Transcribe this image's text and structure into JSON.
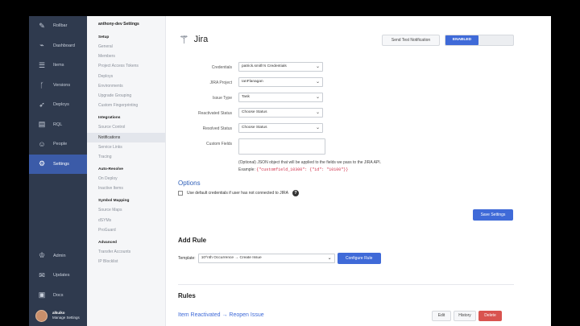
{
  "nav": {
    "items": [
      {
        "label": "Rollbar",
        "icon": "rollbar-logo-icon",
        "glyph": "✎"
      },
      {
        "label": "Dashboard",
        "icon": "dashboard-chart-icon",
        "glyph": "⌁"
      },
      {
        "label": "Items",
        "icon": "items-list-icon",
        "glyph": "☰"
      },
      {
        "label": "Versions",
        "icon": "versions-branch-icon",
        "glyph": "ᚴ"
      },
      {
        "label": "Deploys",
        "icon": "deploys-rocket-icon",
        "glyph": "➶"
      },
      {
        "label": "RQL",
        "icon": "rql-database-icon",
        "glyph": "▤"
      },
      {
        "label": "People",
        "icon": "people-icon",
        "glyph": "☺"
      },
      {
        "label": "Settings",
        "icon": "settings-gear-icon",
        "glyph": "⚙"
      }
    ],
    "bottom": [
      {
        "label": "Admin",
        "icon": "admin-icon",
        "glyph": "♔"
      },
      {
        "label": "Updates",
        "icon": "updates-megaphone-icon",
        "glyph": "✉"
      },
      {
        "label": "Docs",
        "icon": "docs-book-icon",
        "glyph": "▣"
      }
    ],
    "user": {
      "name": "alkuiko",
      "sub": "Manage Settings"
    }
  },
  "settings": {
    "title": "anthony-dev Settings",
    "groups": [
      {
        "head": "Setup",
        "items": [
          "General",
          "Members",
          "Project Access Tokens",
          "Deploys",
          "Environments",
          "Upgrade Grouping",
          "Custom Fingerprinting"
        ]
      },
      {
        "head": "Integrations",
        "items": [
          "Source Control",
          "Notifications",
          "Service Links",
          "Tracing"
        ]
      },
      {
        "head": "Auto-Resolve",
        "items": [
          "On Deploy",
          "Inactive Items"
        ]
      },
      {
        "head": "Symbol Mapping",
        "items": [
          "Source Maps",
          "dSYMs",
          "ProGuard"
        ]
      },
      {
        "head": "Advanced",
        "items": [
          "Transfer Accounts",
          "IP Blocklist"
        ]
      }
    ],
    "active": "Notifications"
  },
  "header": {
    "title": "Jira",
    "test_button": "Send Test Notification",
    "toggle_label": "ENABLED"
  },
  "form": {
    "fields": [
      {
        "label": "Credentials",
        "value": "patrick.smith's Credentials"
      },
      {
        "label": "JIRA Project",
        "value": "IanFlanagan"
      },
      {
        "label": "Issue Type",
        "value": "Task"
      },
      {
        "label": "Reactivated Status",
        "value": "Choose Status"
      },
      {
        "label": "Resolved Status",
        "value": "Choose Status"
      }
    ],
    "custom_fields_label": "Custom Fields",
    "help_line": "(Optional) JSON object that will be applied to the fields we pass to the JIRA API.",
    "example_label": "Example:",
    "example_code": "{\"customfield_10300\": {\"id\": \"10100\"}}"
  },
  "options": {
    "title": "Options",
    "checkbox_label": "Use default credentials if user has not connected to JIRA",
    "checked": false,
    "save_button": "Save Settings"
  },
  "add_rule": {
    "title": "Add Rule",
    "template_label": "Template:",
    "template_value": "10^nth Occurrence → Create Issue",
    "configure_button": "Configure Rule"
  },
  "rules": {
    "title": "Rules",
    "items": [
      {
        "name": "Item Reactivated → Reopen Issue",
        "edit": "Edit",
        "history": "History",
        "delete": "Delete"
      }
    ]
  },
  "colors": {
    "accent": "#3f6ad8",
    "nav_bg": "#2f3a4e",
    "danger": "#d9534f",
    "code": "#d0304a"
  }
}
